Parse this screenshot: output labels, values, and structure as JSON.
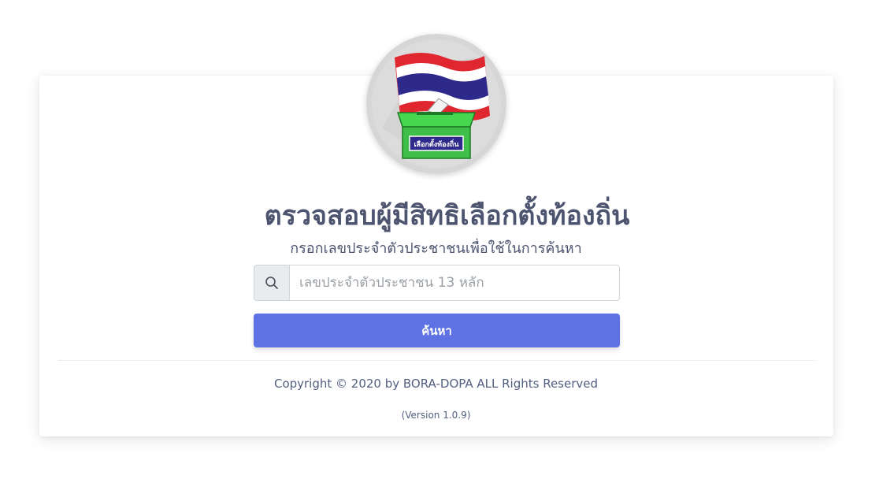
{
  "page": {
    "title": "ตรวจสอบผู้มีสิทธิเลือกตั้งท้องถิ่น",
    "subtitle": "กรอกเลขประจำตัวประชาชนเพื่อใช้ในการค้นหา"
  },
  "logo": {
    "ballot_box_label": "เลือกตั้งท้องถิ่น"
  },
  "search": {
    "icon": "search-icon",
    "placeholder": "เลขประจำตัวประชาชน 13 หลัก",
    "value": "",
    "button_label": "ค้นหา"
  },
  "footer": {
    "copyright": "Copyright © 2020 by BORA-DOPA ALL Rights Reserved",
    "version": "(Version 1.0.9)"
  },
  "colors": {
    "primary": "#5e72e4",
    "title_text": "#4d5470",
    "flag_red": "#e0262e",
    "flag_blue": "#2d2a8c",
    "box_green": "#3fbf4a"
  }
}
